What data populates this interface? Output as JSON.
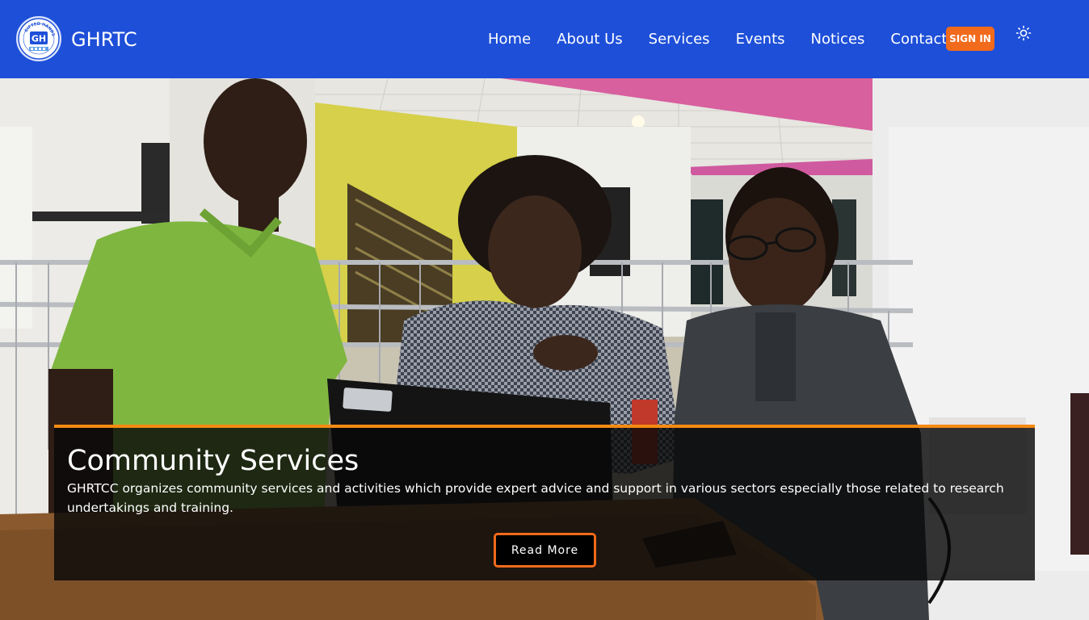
{
  "brand": {
    "name": "GHRTC",
    "logo_text": "GH",
    "logo_ring_text": "GIFTED HANDS"
  },
  "nav": {
    "links": [
      "Home",
      "About Us",
      "Services",
      "Events",
      "Notices",
      "Contact Us"
    ],
    "signin_label": "SIGN IN",
    "theme_toggle_icon": "sun-icon"
  },
  "hero": {
    "title": "Community Services",
    "description": "GHRTCC organizes community services and activities which provide expert advice and support in various sectors especially those related to research undertakings and training.",
    "button_label": "Read More"
  },
  "colors": {
    "navbar": "#1e4fd8",
    "accent_orange": "#f26a1b",
    "caption_border": "#f58a12"
  }
}
